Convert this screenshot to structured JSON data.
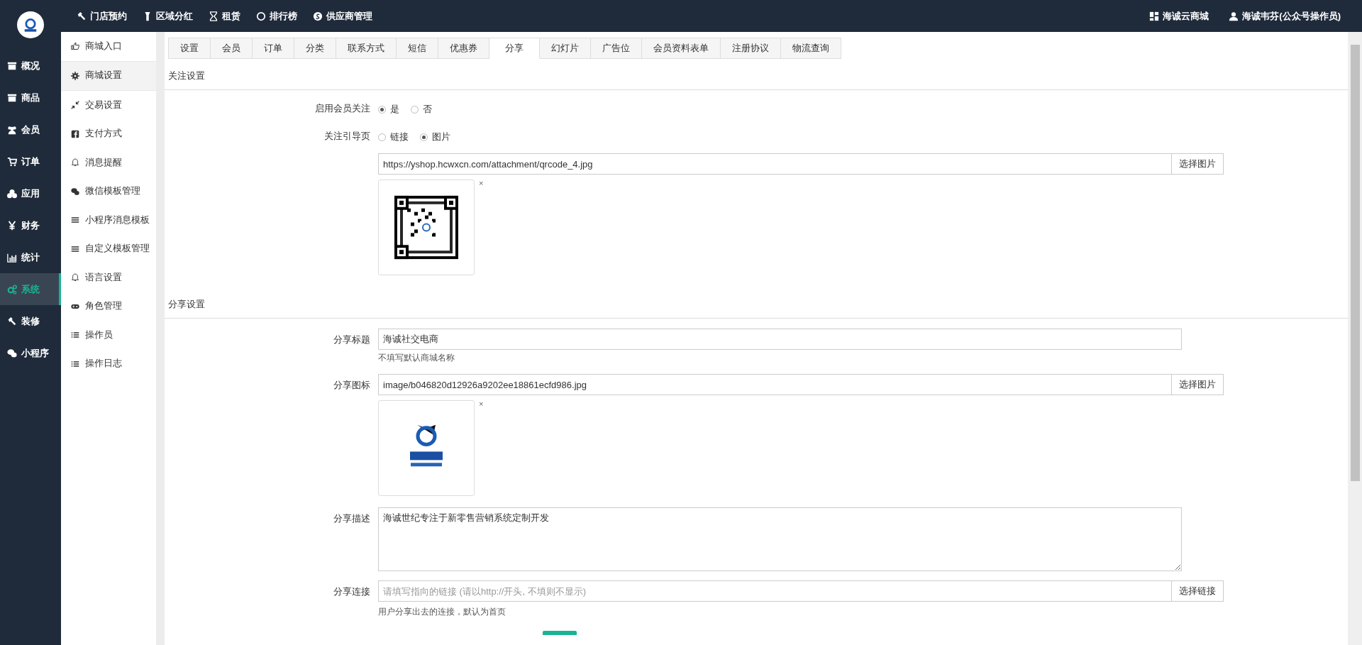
{
  "top_nav": {
    "items": [
      {
        "label": "门店预约"
      },
      {
        "label": "区域分红"
      },
      {
        "label": "租赁"
      },
      {
        "label": "排行榜"
      },
      {
        "label": "供应商管理"
      }
    ],
    "right": [
      {
        "label": "海诚云商城"
      },
      {
        "label": "海诚韦芬(公众号操作员)"
      }
    ]
  },
  "main_menu": [
    {
      "label": "概况",
      "selected": false
    },
    {
      "label": "商品",
      "selected": false
    },
    {
      "label": "会员",
      "selected": false
    },
    {
      "label": "订单",
      "selected": false
    },
    {
      "label": "应用",
      "selected": false
    },
    {
      "label": "财务",
      "selected": false
    },
    {
      "label": "统计",
      "selected": false
    },
    {
      "label": "系统",
      "selected": true
    },
    {
      "label": "装修",
      "selected": false
    },
    {
      "label": "小程序",
      "selected": false
    }
  ],
  "sub_menu": [
    {
      "label": "商城入口",
      "selected": false
    },
    {
      "label": "商城设置",
      "selected": true
    },
    {
      "label": "交易设置",
      "selected": false
    },
    {
      "label": "支付方式",
      "selected": false
    },
    {
      "label": "消息提醒",
      "selected": false
    },
    {
      "label": "微信模板管理",
      "selected": false
    },
    {
      "label": "小程序消息模板",
      "selected": false
    },
    {
      "label": "自定义模板管理",
      "selected": false
    },
    {
      "label": "语言设置",
      "selected": false
    },
    {
      "label": "角色管理",
      "selected": false
    },
    {
      "label": "操作员",
      "selected": false
    },
    {
      "label": "操作日志",
      "selected": false
    }
  ],
  "tabs": [
    {
      "label": "设置",
      "selected": false
    },
    {
      "label": "会员",
      "selected": false
    },
    {
      "label": "订单",
      "selected": false
    },
    {
      "label": "分类",
      "selected": false
    },
    {
      "label": "联系方式",
      "selected": false
    },
    {
      "label": "短信",
      "selected": false
    },
    {
      "label": "优惠券",
      "selected": false
    },
    {
      "label": "分享",
      "selected": true
    },
    {
      "label": "幻灯片",
      "selected": false
    },
    {
      "label": "广告位",
      "selected": false
    },
    {
      "label": "会员资料表单",
      "selected": false
    },
    {
      "label": "注册协议",
      "selected": false
    },
    {
      "label": "物流查询",
      "selected": false
    }
  ],
  "follow_settings": {
    "title": "关注设置",
    "enable_follow": {
      "label": "启用会员关注",
      "options": [
        {
          "label": "是",
          "selected": true
        },
        {
          "label": "否",
          "selected": false
        }
      ]
    },
    "guide_page": {
      "label": "关注引导页",
      "options": [
        {
          "label": "链接",
          "selected": false
        },
        {
          "label": "图片",
          "selected": true
        }
      ]
    },
    "image_url": {
      "value": "https://yshop.hcwxcn.com/attachment/qrcode_4.jpg",
      "button": "选择图片",
      "remove": "×"
    }
  },
  "share_settings": {
    "title": "分享设置",
    "share_title": {
      "label": "分享标题",
      "value": "海诚社交电商",
      "hint": "不填写默认商城名称"
    },
    "share_icon": {
      "label": "分享图标",
      "value": "image/b046820d12926a9202ee18861ecfd986.jpg",
      "button": "选择图片",
      "remove": "×"
    },
    "share_description": {
      "label": "分享描述",
      "value": "海诚世纪专注于新零售营销系统定制开发"
    },
    "share_link": {
      "label": "分享连接",
      "placeholder": "请填写指向的链接 (请以http://开头, 不填则不显示)",
      "button": "选择链接",
      "hint": "用户分享出去的连接，默认为首页"
    }
  }
}
